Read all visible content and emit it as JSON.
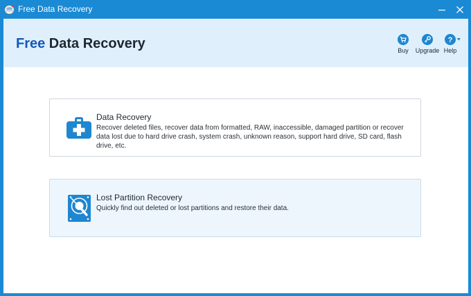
{
  "window": {
    "title": "Free Data Recovery",
    "colors": {
      "frame": "#1a8ad4",
      "header": "#dff0fc",
      "accent": "#1558b8",
      "icon": "#1f86d0"
    }
  },
  "header": {
    "brand_accent": "Free",
    "brand_rest": " Data Recovery",
    "toolbar": [
      {
        "label": "Buy",
        "icon": "cart-icon"
      },
      {
        "label": "Upgrade",
        "icon": "key-icon"
      },
      {
        "label": "Help",
        "icon": "help-icon"
      }
    ]
  },
  "options": [
    {
      "title": "Data Recovery",
      "icon": "medical-kit-icon",
      "description": "Recover deleted files, recover data from formatted, RAW, inaccessible, damaged partition or recover data lost due to hard drive crash, system crash, unknown reason, support hard drive, SD card, flash drive, etc."
    },
    {
      "title": "Lost Partition Recovery",
      "icon": "disk-search-icon",
      "description": "Quickly find out deleted or lost partitions and restore their data."
    }
  ]
}
